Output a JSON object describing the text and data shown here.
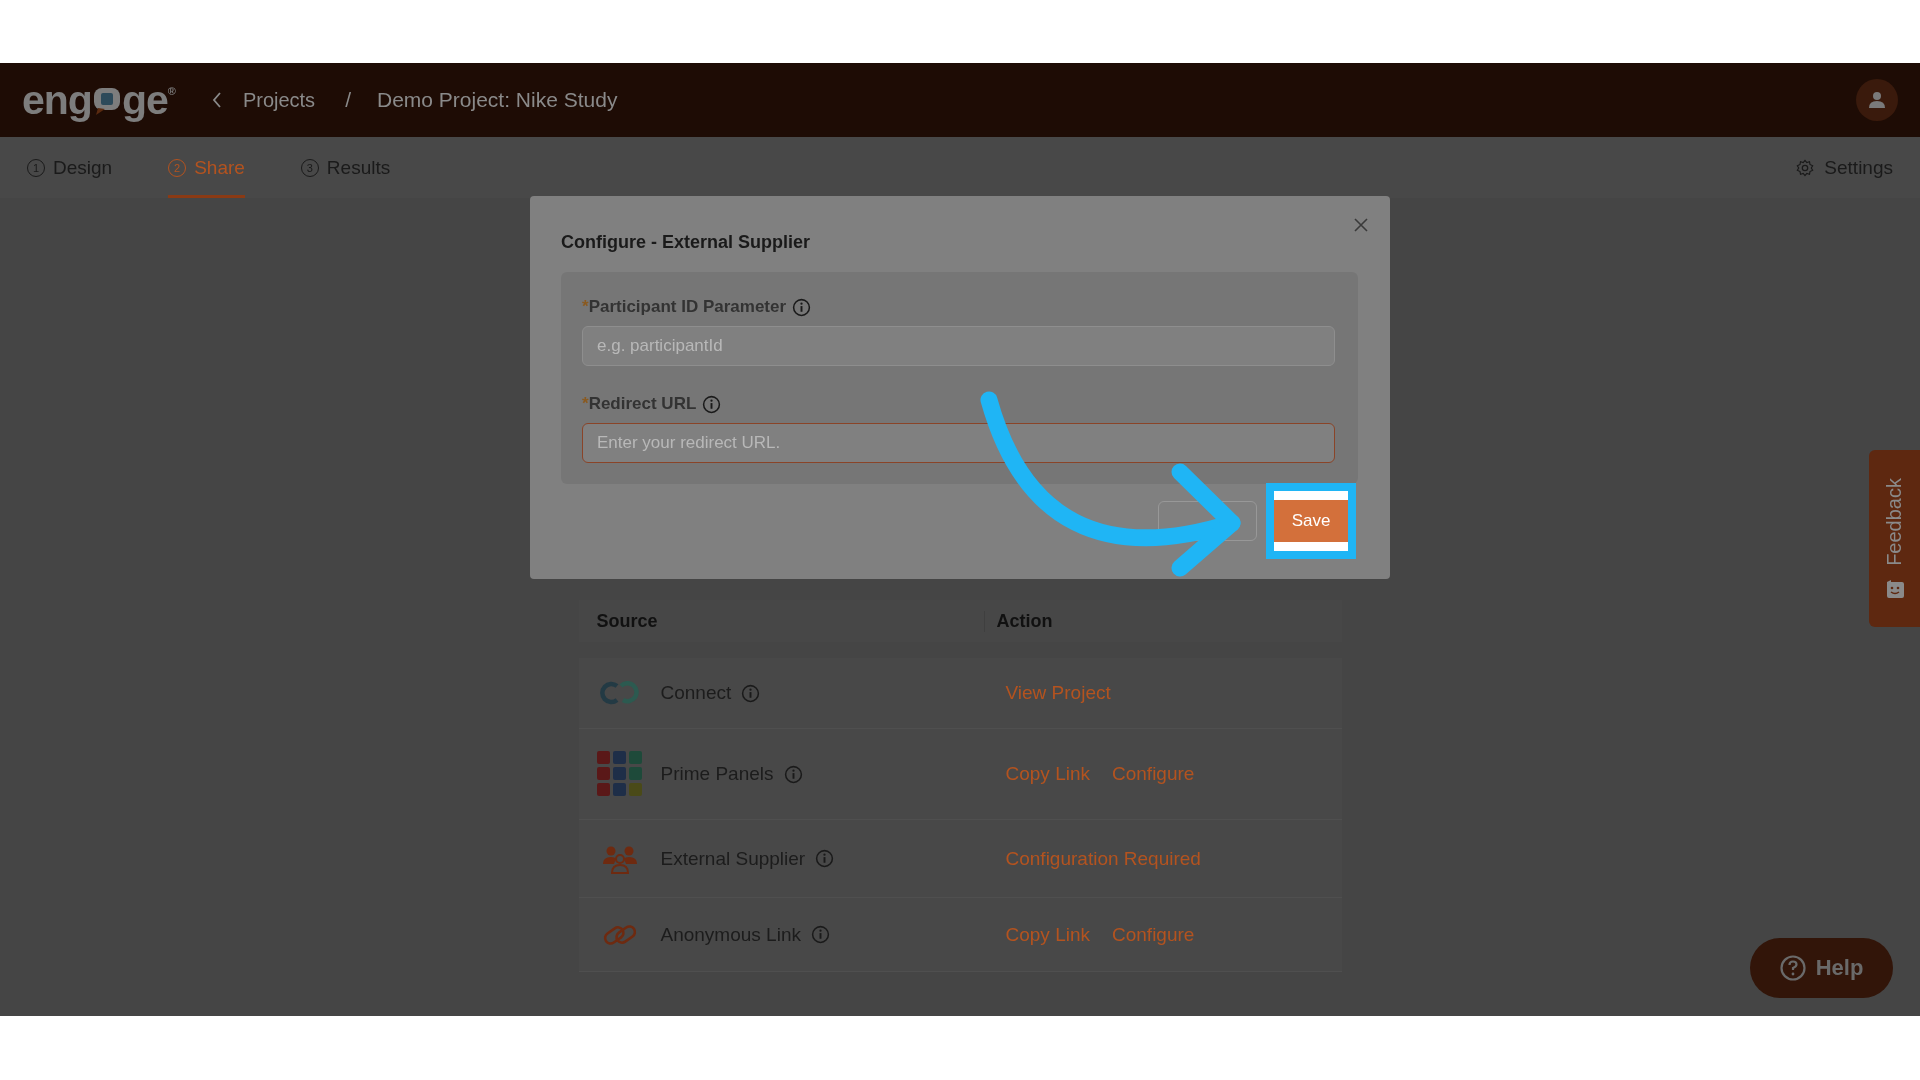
{
  "header": {
    "logo": {
      "text_left": "eng",
      "text_right": "ge",
      "registered": "®"
    },
    "breadcrumbs": [
      {
        "label": "Projects",
        "kind": "link"
      },
      {
        "label": "/",
        "kind": "separator"
      },
      {
        "label": "Demo Project: Nike Study",
        "kind": "current"
      }
    ]
  },
  "tabs": [
    {
      "step": "1",
      "label": "Design",
      "selected": false
    },
    {
      "step": "2",
      "label": "Share",
      "selected": true
    },
    {
      "step": "3",
      "label": "Results",
      "selected": false
    }
  ],
  "settings": "Settings",
  "modal": {
    "title": "Configure - External Supplier",
    "fields": [
      {
        "label": "Participant ID Parameter",
        "required_mark": "*",
        "placeholder": "e.g. participantId",
        "error": false
      },
      {
        "label": "Redirect URL",
        "required_mark": "*",
        "placeholder": "Enter your redirect URL.",
        "error": true
      }
    ],
    "save_button": "Save"
  },
  "table": {
    "columns": [
      "Source",
      "Action"
    ],
    "rows": [
      {
        "source": "Connect",
        "kind": "connect",
        "actions": [
          "View Project"
        ]
      },
      {
        "source": "Prime Panels",
        "kind": "grid",
        "actions": [
          "Copy Link",
          "Configure"
        ]
      },
      {
        "source": "External Supplier",
        "kind": "people",
        "actions": [
          "Configuration Required"
        ]
      },
      {
        "source": "Anonymous Link",
        "kind": "link",
        "actions": [
          "Copy Link",
          "Configure"
        ]
      }
    ]
  },
  "feedback": "Feedback",
  "help": "Help"
}
